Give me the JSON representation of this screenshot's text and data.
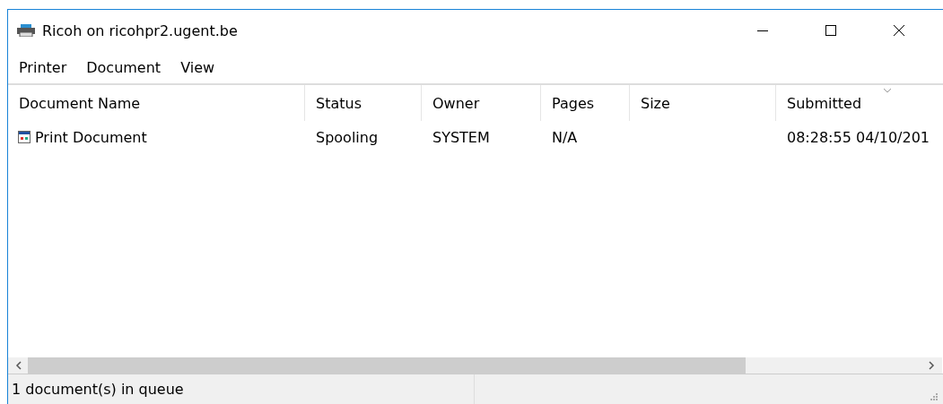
{
  "window": {
    "title": "Ricoh on ricohpr2.ugent.be"
  },
  "menu": [
    "Printer",
    "Document",
    "View"
  ],
  "table": {
    "columns": [
      {
        "label": "Document Name",
        "sorted": false
      },
      {
        "label": "Status",
        "sorted": false
      },
      {
        "label": "Owner",
        "sorted": false
      },
      {
        "label": "Pages",
        "sorted": false
      },
      {
        "label": "Size",
        "sorted": false
      },
      {
        "label": "Submitted",
        "sorted": true
      }
    ],
    "rows": [
      {
        "cells": [
          "Print Document",
          "Spooling",
          "SYSTEM",
          "N/A",
          "",
          "08:28:55  04/10/201"
        ]
      }
    ]
  },
  "status_bar": [
    "1 document(s) in queue"
  ]
}
